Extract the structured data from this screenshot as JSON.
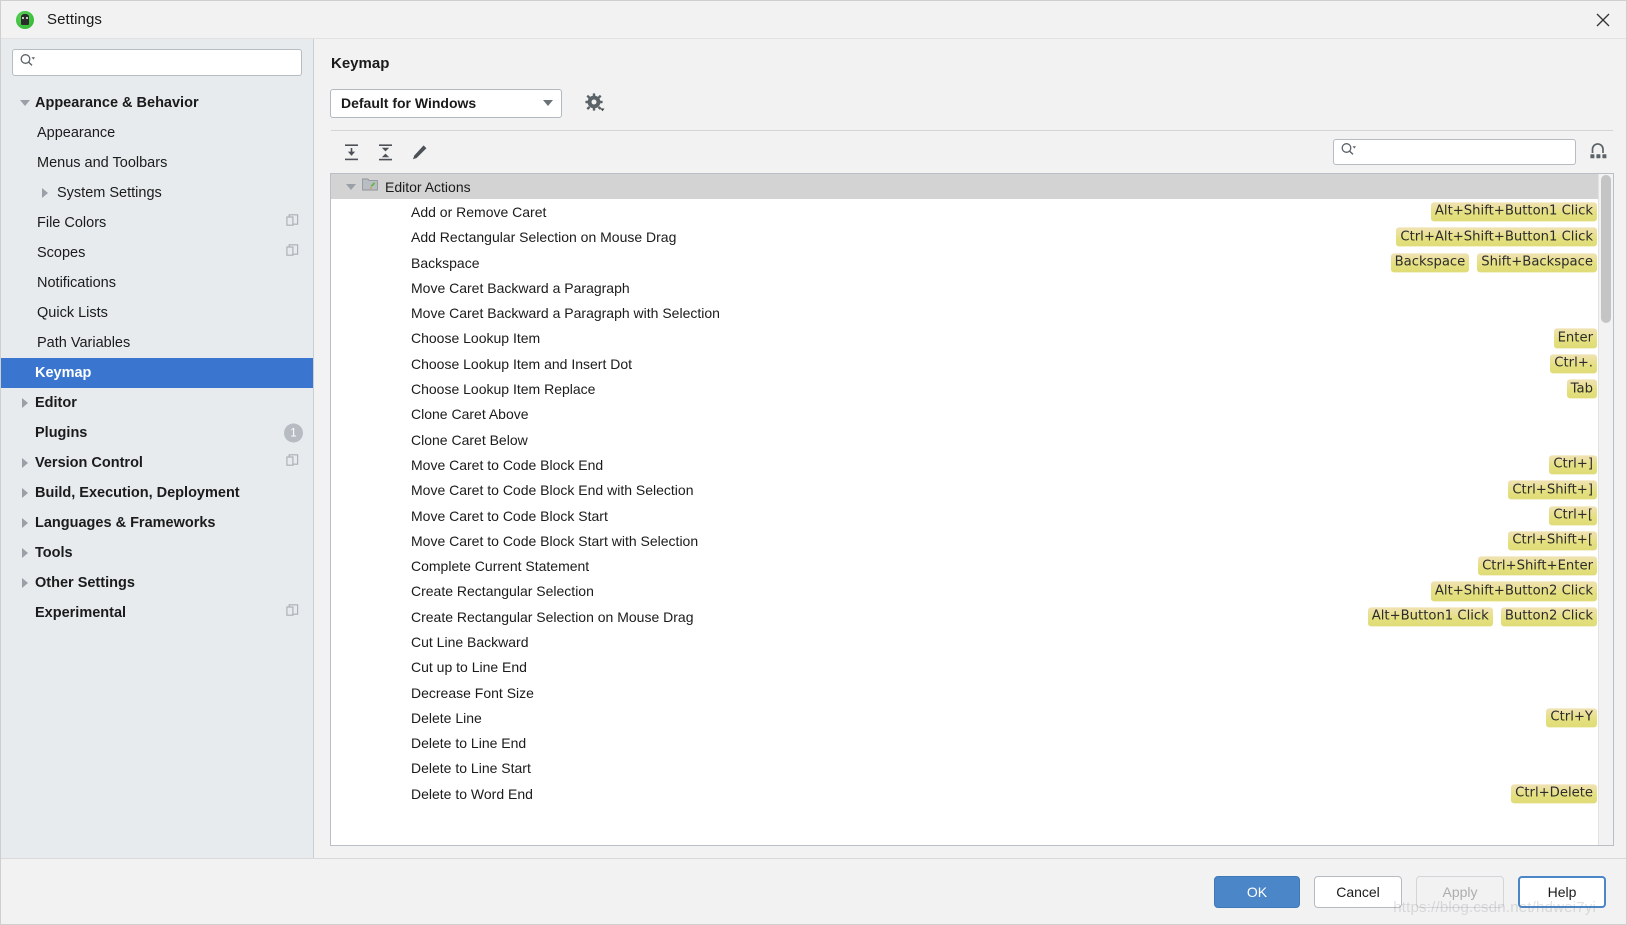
{
  "window": {
    "title": "Settings",
    "app_icon": "android-studio-icon",
    "close_icon": "close-icon"
  },
  "sidebar": {
    "search": {
      "placeholder": "",
      "value": "",
      "icon": "search-icon"
    },
    "items": [
      {
        "label": "Appearance & Behavior",
        "level": 0,
        "arrow": "down",
        "selected": false,
        "badge": ""
      },
      {
        "label": "Appearance",
        "level": 1,
        "arrow": "none",
        "selected": false,
        "badge": ""
      },
      {
        "label": "Menus and Toolbars",
        "level": 1,
        "arrow": "none",
        "selected": false,
        "badge": ""
      },
      {
        "label": "System Settings",
        "level": 1,
        "arrow": "right",
        "selected": false,
        "badge": ""
      },
      {
        "label": "File Colors",
        "level": 1,
        "arrow": "none",
        "selected": false,
        "badge": "copy"
      },
      {
        "label": "Scopes",
        "level": 1,
        "arrow": "none",
        "selected": false,
        "badge": "copy"
      },
      {
        "label": "Notifications",
        "level": 1,
        "arrow": "none",
        "selected": false,
        "badge": ""
      },
      {
        "label": "Quick Lists",
        "level": 1,
        "arrow": "none",
        "selected": false,
        "badge": ""
      },
      {
        "label": "Path Variables",
        "level": 1,
        "arrow": "none",
        "selected": false,
        "badge": ""
      },
      {
        "label": "Keymap",
        "level": 0,
        "arrow": "none",
        "selected": true,
        "badge": ""
      },
      {
        "label": "Editor",
        "level": 0,
        "arrow": "right",
        "selected": false,
        "badge": ""
      },
      {
        "label": "Plugins",
        "level": 0,
        "arrow": "none",
        "selected": false,
        "badge": "1"
      },
      {
        "label": "Version Control",
        "level": 0,
        "arrow": "right",
        "selected": false,
        "badge": "copy"
      },
      {
        "label": "Build, Execution, Deployment",
        "level": 0,
        "arrow": "right",
        "selected": false,
        "badge": ""
      },
      {
        "label": "Languages & Frameworks",
        "level": 0,
        "arrow": "right",
        "selected": false,
        "badge": ""
      },
      {
        "label": "Tools",
        "level": 0,
        "arrow": "right",
        "selected": false,
        "badge": ""
      },
      {
        "label": "Other Settings",
        "level": 0,
        "arrow": "right",
        "selected": false,
        "badge": ""
      },
      {
        "label": "Experimental",
        "level": 0,
        "arrow": "none",
        "selected": false,
        "badge": "copy"
      }
    ]
  },
  "panel": {
    "title": "Keymap",
    "keymap_select": {
      "value": "Default for Windows",
      "icon": "chevron-down-icon"
    },
    "gear_icon": "gear-icon",
    "toolbar": [
      {
        "name": "expand-all-icon"
      },
      {
        "name": "collapse-all-icon"
      },
      {
        "name": "edit-shortcut-icon"
      }
    ],
    "filter": {
      "placeholder": "",
      "value": "",
      "icon": "search-icon"
    },
    "find_by_shortcut_icon": "keyboard-shortcut-filter-icon"
  },
  "actions": {
    "group": {
      "label": "Editor Actions",
      "icon": "folder-icon",
      "expanded": true
    },
    "rows": [
      {
        "label": "Add or Remove Caret",
        "shortcuts": [
          "Alt+Shift+Button1 Click"
        ]
      },
      {
        "label": "Add Rectangular Selection on Mouse Drag",
        "shortcuts": [
          "Ctrl+Alt+Shift+Button1 Click"
        ]
      },
      {
        "label": "Backspace",
        "shortcuts": [
          "Backspace",
          "Shift+Backspace"
        ]
      },
      {
        "label": "Move Caret Backward a Paragraph",
        "shortcuts": []
      },
      {
        "label": "Move Caret Backward a Paragraph with Selection",
        "shortcuts": []
      },
      {
        "label": "Choose Lookup Item",
        "shortcuts": [
          "Enter"
        ]
      },
      {
        "label": "Choose Lookup Item and Insert Dot",
        "shortcuts": [
          "Ctrl+."
        ]
      },
      {
        "label": "Choose Lookup Item Replace",
        "shortcuts": [
          "Tab"
        ]
      },
      {
        "label": "Clone Caret Above",
        "shortcuts": []
      },
      {
        "label": "Clone Caret Below",
        "shortcuts": []
      },
      {
        "label": "Move Caret to Code Block End",
        "shortcuts": [
          "Ctrl+]"
        ]
      },
      {
        "label": "Move Caret to Code Block End with Selection",
        "shortcuts": [
          "Ctrl+Shift+]"
        ]
      },
      {
        "label": "Move Caret to Code Block Start",
        "shortcuts": [
          "Ctrl+["
        ]
      },
      {
        "label": "Move Caret to Code Block Start with Selection",
        "shortcuts": [
          "Ctrl+Shift+["
        ]
      },
      {
        "label": "Complete Current Statement",
        "shortcuts": [
          "Ctrl+Shift+Enter"
        ]
      },
      {
        "label": "Create Rectangular Selection",
        "shortcuts": [
          "Alt+Shift+Button2 Click"
        ]
      },
      {
        "label": "Create Rectangular Selection on Mouse Drag",
        "shortcuts": [
          "Alt+Button1 Click",
          "Button2 Click"
        ]
      },
      {
        "label": "Cut Line Backward",
        "shortcuts": []
      },
      {
        "label": "Cut up to Line End",
        "shortcuts": []
      },
      {
        "label": "Decrease Font Size",
        "shortcuts": []
      },
      {
        "label": "Delete Line",
        "shortcuts": [
          "Ctrl+Y"
        ]
      },
      {
        "label": "Delete to Line End",
        "shortcuts": []
      },
      {
        "label": "Delete to Line Start",
        "shortcuts": []
      },
      {
        "label": "Delete to Word End",
        "shortcuts": [
          "Ctrl+Delete"
        ]
      }
    ]
  },
  "footer": {
    "ok": "OK",
    "cancel": "Cancel",
    "apply": "Apply",
    "help": "Help",
    "watermark": "https://blog.csdn.net/hdwei7yi"
  },
  "colors": {
    "accent": "#3a76cf",
    "primary_button": "#4a86c8",
    "shortcut_badge": "#e5e07e",
    "sidebar_bg": "#e7ebee",
    "group_row_bg": "#d3d3d3"
  }
}
